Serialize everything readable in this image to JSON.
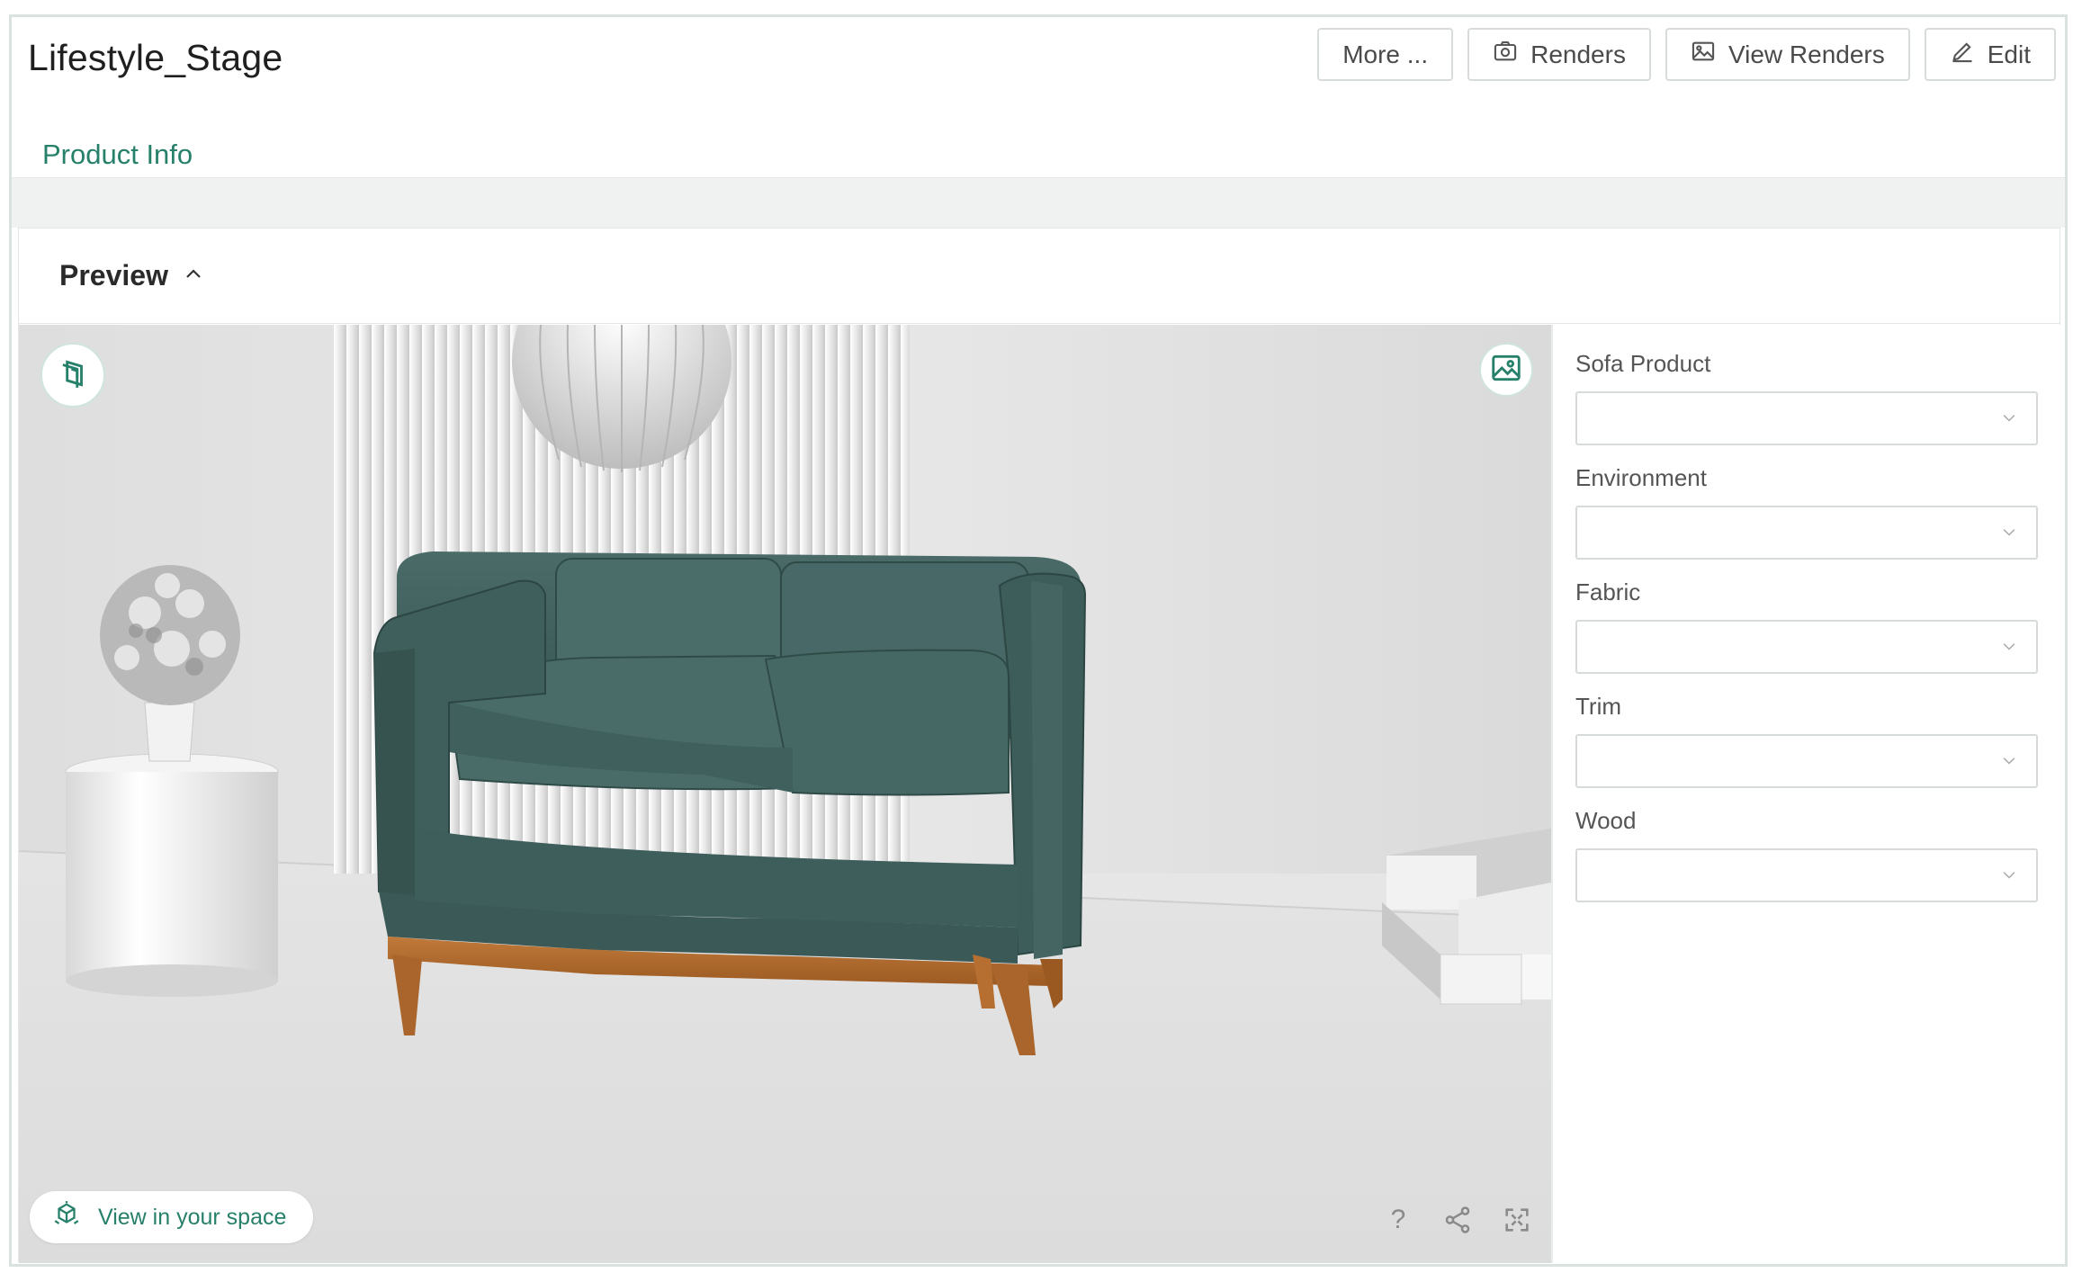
{
  "header": {
    "title": "Lifestyle_Stage",
    "buttons": {
      "more": "More ...",
      "renders": "Renders",
      "view_renders": "View Renders",
      "edit": "Edit"
    }
  },
  "tabs": [
    {
      "label": "Product Info",
      "active": true
    }
  ],
  "preview": {
    "title": "Preview",
    "ar_button": "View in your space",
    "viewer_tools": [
      "?",
      "share-icon",
      "fullscreen-icon"
    ]
  },
  "config": {
    "fields": [
      {
        "label": "Sofa Product",
        "value": ""
      },
      {
        "label": "Environment",
        "value": ""
      },
      {
        "label": "Fabric",
        "value": ""
      },
      {
        "label": "Trim",
        "value": ""
      },
      {
        "label": "Wood",
        "value": ""
      }
    ]
  },
  "colors": {
    "accent": "#26806a",
    "sofa": "#3e5f5c",
    "wood": "#b06a2c",
    "border": "#d7dcda"
  }
}
